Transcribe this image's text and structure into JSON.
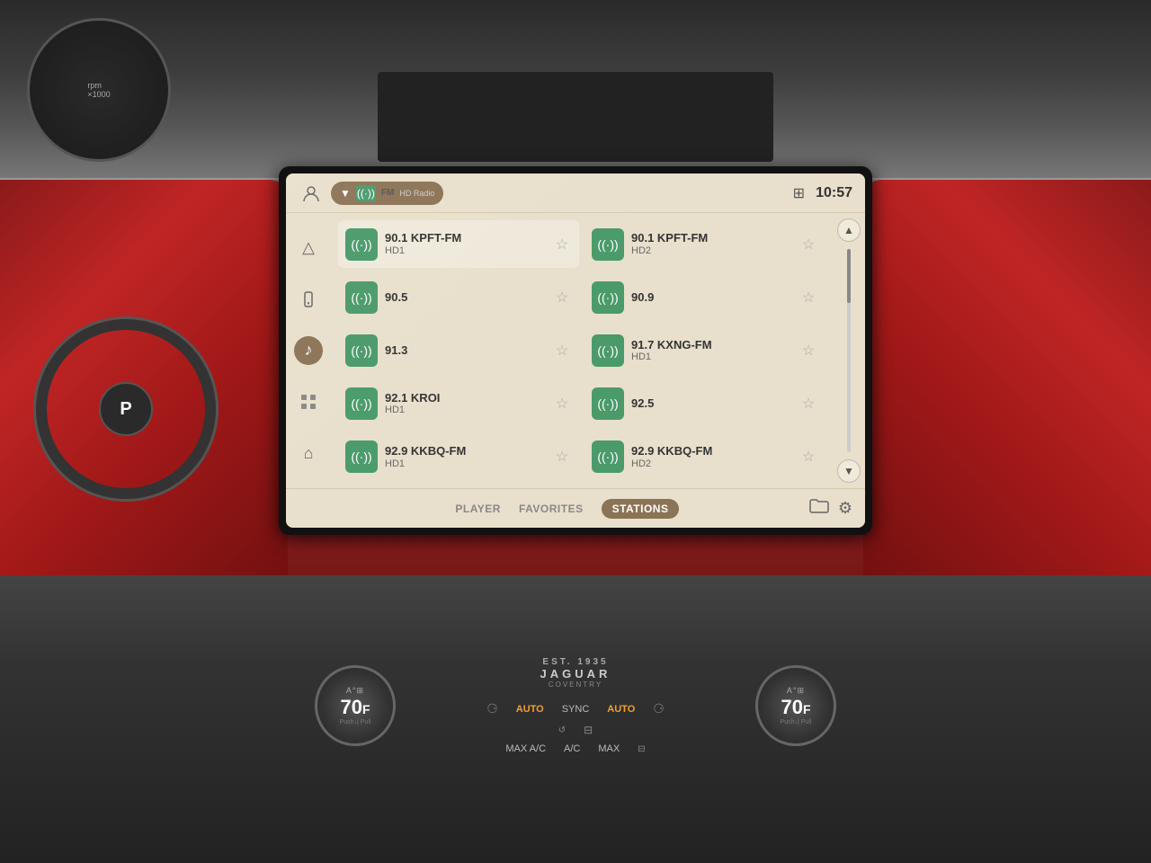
{
  "screen": {
    "time": "10:57",
    "source": {
      "label": "Radio",
      "type": "FM",
      "badge": "HD Radio"
    },
    "tabs": [
      {
        "id": "player",
        "label": "PLAYER",
        "active": false
      },
      {
        "id": "favorites",
        "label": "FAVORITES",
        "active": false
      },
      {
        "id": "stations",
        "label": "STATIONS",
        "active": true
      }
    ],
    "stations": [
      {
        "freq": "90.1 KPFT-FM",
        "sub": "HD1",
        "col": 0
      },
      {
        "freq": "90.1 KPFT-FM",
        "sub": "HD2",
        "col": 1
      },
      {
        "freq": "90.5",
        "sub": "",
        "col": 0
      },
      {
        "freq": "90.9",
        "sub": "",
        "col": 1
      },
      {
        "freq": "91.3",
        "sub": "",
        "col": 0
      },
      {
        "freq": "91.7 KXNG-FM",
        "sub": "HD1",
        "col": 1
      },
      {
        "freq": "92.1 KROI",
        "sub": "HD1",
        "col": 0
      },
      {
        "freq": "92.5",
        "sub": "",
        "col": 1
      },
      {
        "freq": "92.9 KKBQ-FM",
        "sub": "HD1",
        "col": 0
      },
      {
        "freq": "92.9 KKBQ-FM",
        "sub": "HD2",
        "col": 1
      }
    ],
    "sidebar_icons": [
      {
        "id": "nav",
        "symbol": "△",
        "active": false
      },
      {
        "id": "phone",
        "symbol": "☎",
        "active": false
      },
      {
        "id": "music",
        "symbol": "♪",
        "active": true
      },
      {
        "id": "apps",
        "symbol": "⊞",
        "active": false
      },
      {
        "id": "home",
        "symbol": "⌂",
        "active": false
      }
    ]
  },
  "climate": {
    "left_temp": "70",
    "left_unit": "F",
    "right_temp": "70",
    "right_unit": "F",
    "left_sub": "Push↓| Pull",
    "right_sub": "Push↓| Pull",
    "mode": "AUTO",
    "sync": "SYNC",
    "mode2": "AUTO",
    "fan_label": "MAX A/C",
    "ac_label": "A/C",
    "heat_label": "MAX"
  },
  "jaguar": {
    "est": "EST. 1935",
    "name": "JAGUAR",
    "location": "COVENTRY"
  }
}
